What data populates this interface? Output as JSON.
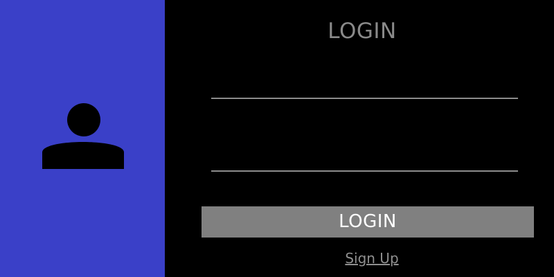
{
  "side_panel": {
    "background_color": "#3a40c8",
    "icon": "user-avatar-icon"
  },
  "form": {
    "title": "LOGIN",
    "username_field": {
      "value": "",
      "placeholder": ""
    },
    "password_field": {
      "value": "",
      "placeholder": ""
    },
    "login_button_label": "LOGIN",
    "signup_link_label": "Sign Up"
  },
  "colors": {
    "background": "#000000",
    "accent": "#3a40c8",
    "button": "#808080",
    "muted_text": "#8a8a8a"
  }
}
